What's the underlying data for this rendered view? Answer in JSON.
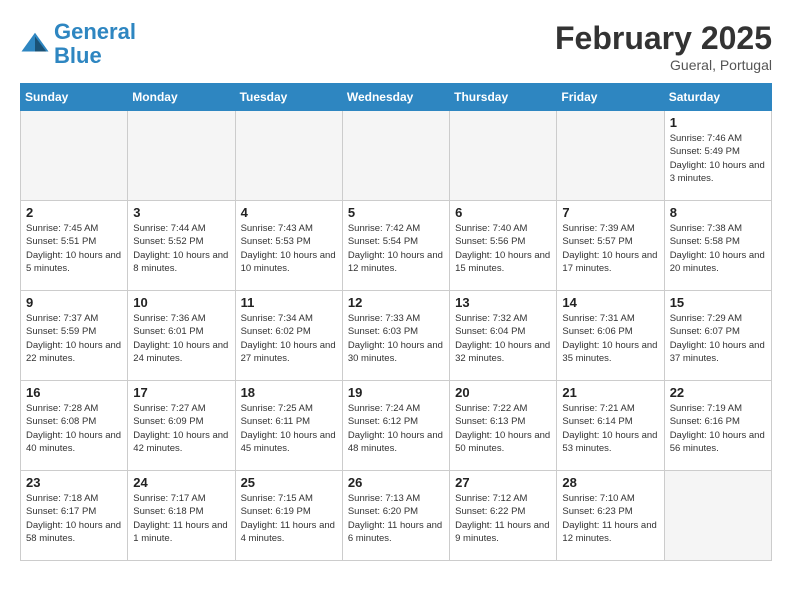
{
  "header": {
    "logo_line1": "General",
    "logo_line2": "Blue",
    "month_title": "February 2025",
    "location": "Gueral, Portugal"
  },
  "weekdays": [
    "Sunday",
    "Monday",
    "Tuesday",
    "Wednesday",
    "Thursday",
    "Friday",
    "Saturday"
  ],
  "weeks": [
    [
      {
        "day": "",
        "info": ""
      },
      {
        "day": "",
        "info": ""
      },
      {
        "day": "",
        "info": ""
      },
      {
        "day": "",
        "info": ""
      },
      {
        "day": "",
        "info": ""
      },
      {
        "day": "",
        "info": ""
      },
      {
        "day": "1",
        "info": "Sunrise: 7:46 AM\nSunset: 5:49 PM\nDaylight: 10 hours and 3 minutes."
      }
    ],
    [
      {
        "day": "2",
        "info": "Sunrise: 7:45 AM\nSunset: 5:51 PM\nDaylight: 10 hours and 5 minutes."
      },
      {
        "day": "3",
        "info": "Sunrise: 7:44 AM\nSunset: 5:52 PM\nDaylight: 10 hours and 8 minutes."
      },
      {
        "day": "4",
        "info": "Sunrise: 7:43 AM\nSunset: 5:53 PM\nDaylight: 10 hours and 10 minutes."
      },
      {
        "day": "5",
        "info": "Sunrise: 7:42 AM\nSunset: 5:54 PM\nDaylight: 10 hours and 12 minutes."
      },
      {
        "day": "6",
        "info": "Sunrise: 7:40 AM\nSunset: 5:56 PM\nDaylight: 10 hours and 15 minutes."
      },
      {
        "day": "7",
        "info": "Sunrise: 7:39 AM\nSunset: 5:57 PM\nDaylight: 10 hours and 17 minutes."
      },
      {
        "day": "8",
        "info": "Sunrise: 7:38 AM\nSunset: 5:58 PM\nDaylight: 10 hours and 20 minutes."
      }
    ],
    [
      {
        "day": "9",
        "info": "Sunrise: 7:37 AM\nSunset: 5:59 PM\nDaylight: 10 hours and 22 minutes."
      },
      {
        "day": "10",
        "info": "Sunrise: 7:36 AM\nSunset: 6:01 PM\nDaylight: 10 hours and 24 minutes."
      },
      {
        "day": "11",
        "info": "Sunrise: 7:34 AM\nSunset: 6:02 PM\nDaylight: 10 hours and 27 minutes."
      },
      {
        "day": "12",
        "info": "Sunrise: 7:33 AM\nSunset: 6:03 PM\nDaylight: 10 hours and 30 minutes."
      },
      {
        "day": "13",
        "info": "Sunrise: 7:32 AM\nSunset: 6:04 PM\nDaylight: 10 hours and 32 minutes."
      },
      {
        "day": "14",
        "info": "Sunrise: 7:31 AM\nSunset: 6:06 PM\nDaylight: 10 hours and 35 minutes."
      },
      {
        "day": "15",
        "info": "Sunrise: 7:29 AM\nSunset: 6:07 PM\nDaylight: 10 hours and 37 minutes."
      }
    ],
    [
      {
        "day": "16",
        "info": "Sunrise: 7:28 AM\nSunset: 6:08 PM\nDaylight: 10 hours and 40 minutes."
      },
      {
        "day": "17",
        "info": "Sunrise: 7:27 AM\nSunset: 6:09 PM\nDaylight: 10 hours and 42 minutes."
      },
      {
        "day": "18",
        "info": "Sunrise: 7:25 AM\nSunset: 6:11 PM\nDaylight: 10 hours and 45 minutes."
      },
      {
        "day": "19",
        "info": "Sunrise: 7:24 AM\nSunset: 6:12 PM\nDaylight: 10 hours and 48 minutes."
      },
      {
        "day": "20",
        "info": "Sunrise: 7:22 AM\nSunset: 6:13 PM\nDaylight: 10 hours and 50 minutes."
      },
      {
        "day": "21",
        "info": "Sunrise: 7:21 AM\nSunset: 6:14 PM\nDaylight: 10 hours and 53 minutes."
      },
      {
        "day": "22",
        "info": "Sunrise: 7:19 AM\nSunset: 6:16 PM\nDaylight: 10 hours and 56 minutes."
      }
    ],
    [
      {
        "day": "23",
        "info": "Sunrise: 7:18 AM\nSunset: 6:17 PM\nDaylight: 10 hours and 58 minutes."
      },
      {
        "day": "24",
        "info": "Sunrise: 7:17 AM\nSunset: 6:18 PM\nDaylight: 11 hours and 1 minute."
      },
      {
        "day": "25",
        "info": "Sunrise: 7:15 AM\nSunset: 6:19 PM\nDaylight: 11 hours and 4 minutes."
      },
      {
        "day": "26",
        "info": "Sunrise: 7:13 AM\nSunset: 6:20 PM\nDaylight: 11 hours and 6 minutes."
      },
      {
        "day": "27",
        "info": "Sunrise: 7:12 AM\nSunset: 6:22 PM\nDaylight: 11 hours and 9 minutes."
      },
      {
        "day": "28",
        "info": "Sunrise: 7:10 AM\nSunset: 6:23 PM\nDaylight: 11 hours and 12 minutes."
      },
      {
        "day": "",
        "info": ""
      }
    ]
  ]
}
